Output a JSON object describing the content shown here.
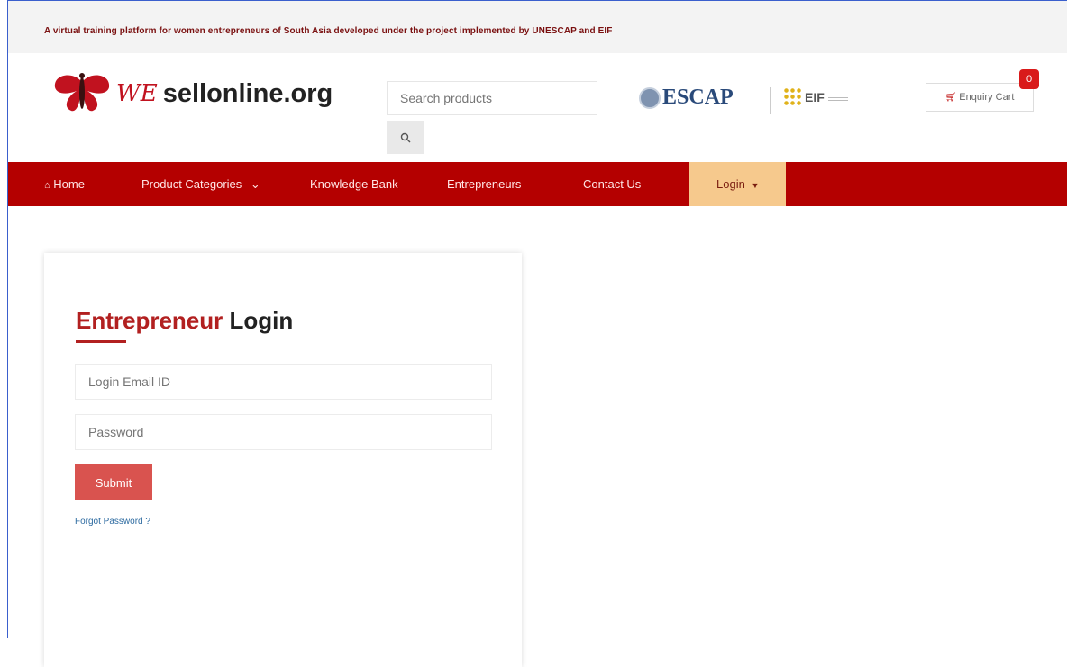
{
  "tagline": "A virtual training platform for women entrepreneurs of South Asia developed under the project implemented by UNESCAP and EIF",
  "logo": {
    "text_accent": "WE",
    "text": "sellonline.org",
    "icon": "butterfly-icon"
  },
  "search": {
    "placeholder": "Search products",
    "icon": "search-icon"
  },
  "partners": {
    "escap": "ESCAP",
    "eif": "EIF"
  },
  "cart": {
    "label": "Enquiry Cart",
    "count": "0"
  },
  "nav": {
    "home": "Home",
    "categories": "Product Categories",
    "knowledge": "Knowledge Bank",
    "entrepreneurs": "Entrepreneurs",
    "contact": "Contact Us",
    "login": "Login"
  },
  "login_card": {
    "title_accent": "Entrepreneur",
    "title_rest": "Login",
    "email_placeholder": "Login Email ID",
    "password_placeholder": "Password",
    "submit": "Submit",
    "forgot": "Forgot Password ?"
  },
  "colors": {
    "nav_bg": "#b40000",
    "login_tab_bg": "#f6c98d",
    "accent": "#b22020",
    "submit_bg": "#d9534f"
  }
}
